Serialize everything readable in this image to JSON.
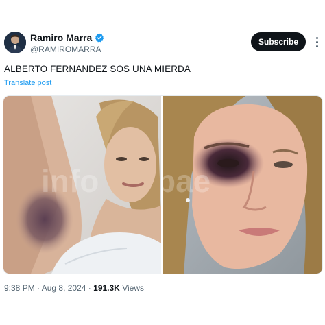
{
  "author": {
    "display_name": "Ramiro Marra",
    "handle": "@RAMIROMARRA",
    "verified": true,
    "verified_color": "#1d9bf0"
  },
  "actions": {
    "subscribe_label": "Subscribe"
  },
  "tweet": {
    "text": "ALBERTO FERNANDEZ SOS UNA MIERDA",
    "translate_label": "Translate post",
    "media_count": 2,
    "watermark": "infobae"
  },
  "meta": {
    "time": "9:38 PM",
    "separator": "·",
    "date": "Aug 8, 2024",
    "views_count": "191.3K",
    "views_label": "Views"
  },
  "colors": {
    "text": "#0f1419",
    "secondary": "#536471",
    "link": "#1d9bf0",
    "button_bg": "#0f1419",
    "button_text": "#ffffff"
  },
  "icons": [
    "verified-badge-icon",
    "more-options-icon"
  ]
}
